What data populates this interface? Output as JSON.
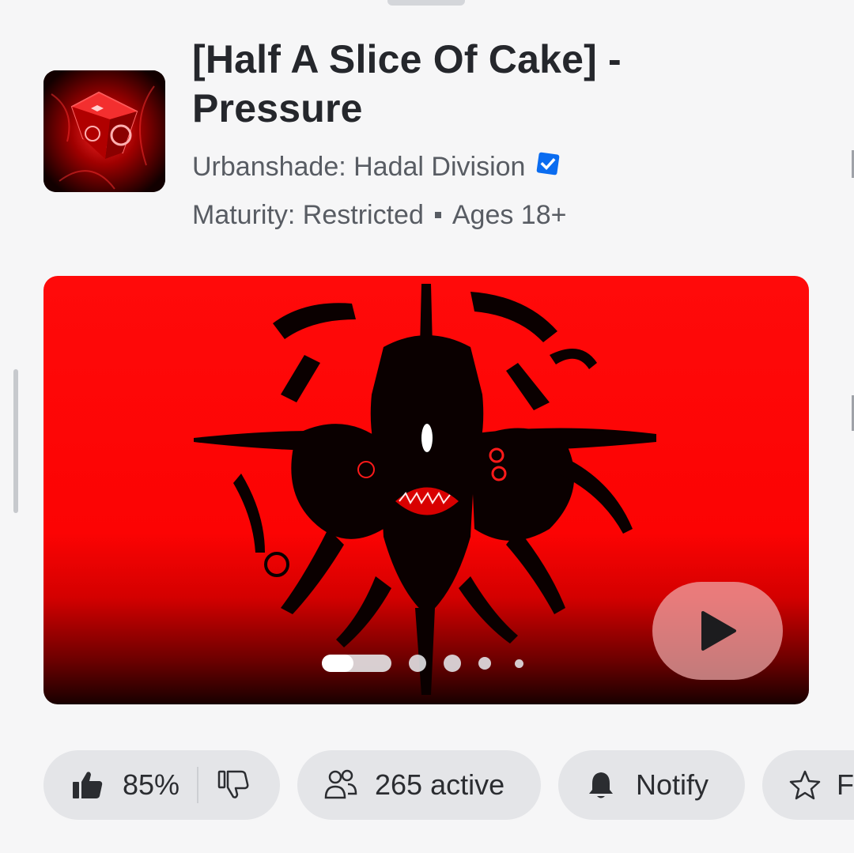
{
  "game": {
    "title_line1": "[Half A Slice Of Cake] -",
    "title_line2": "Pressure",
    "creator": "Urbanshade: Hadal Division",
    "maturity_label": "Maturity: Restricted",
    "age_label": "Ages 18+"
  },
  "media": {
    "slide_count": 5,
    "active_slide": 1
  },
  "stats": {
    "rating": "85%",
    "active_players": "265 active",
    "notify_label": "Notify",
    "favorite_label": "F"
  },
  "colors": {
    "accent_blue": "#0a6cf0",
    "hero_red": "#ff0a0a",
    "pill_background": "#e4e5e8"
  },
  "icons": [
    "thumbs-up-icon",
    "thumbs-down-icon",
    "people-icon",
    "bell-icon",
    "star-icon",
    "play-icon",
    "verified-badge-icon"
  ]
}
